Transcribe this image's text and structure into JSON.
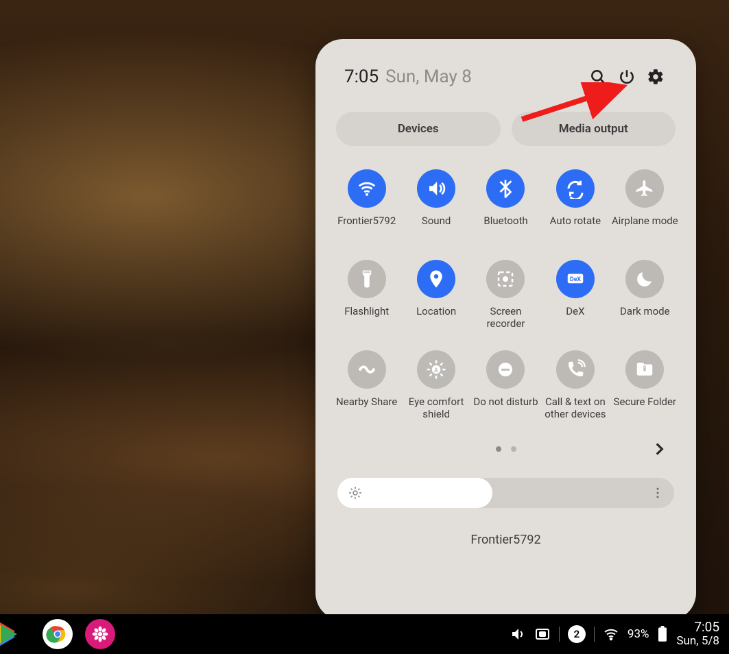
{
  "header": {
    "time": "7:05",
    "date": "Sun, May 8"
  },
  "pills": {
    "devices": "Devices",
    "media": "Media output"
  },
  "tiles": [
    {
      "id": "wifi",
      "label": "Frontier5792",
      "state": "on",
      "icon": "wifi"
    },
    {
      "id": "sound",
      "label": "Sound",
      "state": "on",
      "icon": "sound"
    },
    {
      "id": "bluetooth",
      "label": "Bluetooth",
      "state": "on",
      "icon": "bluetooth"
    },
    {
      "id": "autorotate",
      "label": "Auto rotate",
      "state": "on",
      "icon": "rotate"
    },
    {
      "id": "airplane",
      "label": "Airplane mode",
      "state": "off",
      "icon": "airplane"
    },
    {
      "id": "flashlight",
      "label": "Flashlight",
      "state": "off",
      "icon": "flashlight"
    },
    {
      "id": "location",
      "label": "Location",
      "state": "on",
      "icon": "location"
    },
    {
      "id": "screenrec",
      "label": "Screen recorder",
      "state": "off",
      "icon": "screenrec"
    },
    {
      "id": "dex",
      "label": "DeX",
      "state": "on",
      "icon": "dex"
    },
    {
      "id": "darkmode",
      "label": "Dark mode",
      "state": "off",
      "icon": "moon"
    },
    {
      "id": "nearby",
      "label": "Nearby Share",
      "state": "off",
      "icon": "nearby"
    },
    {
      "id": "eyecomfort",
      "label": "Eye comfort shield",
      "state": "off",
      "icon": "eyecomfort"
    },
    {
      "id": "dnd",
      "label": "Do not disturb",
      "state": "off",
      "icon": "dnd"
    },
    {
      "id": "calltext",
      "label": "Call & text on other devices",
      "state": "off",
      "icon": "calltext"
    },
    {
      "id": "securefolder",
      "label": "Secure Folder",
      "state": "off",
      "icon": "folder"
    }
  ],
  "brightness": {
    "percent": 46
  },
  "footer": {
    "network": "Frontier5792"
  },
  "taskbar": {
    "notif_count": "2",
    "battery": "93%",
    "time": "7:05",
    "date": "Sun, 5/8"
  },
  "colors": {
    "accent": "#2d6df6",
    "inactive": "#bdbab6",
    "panel": "#e2dfdb",
    "arrow": "#ef1c1c"
  }
}
